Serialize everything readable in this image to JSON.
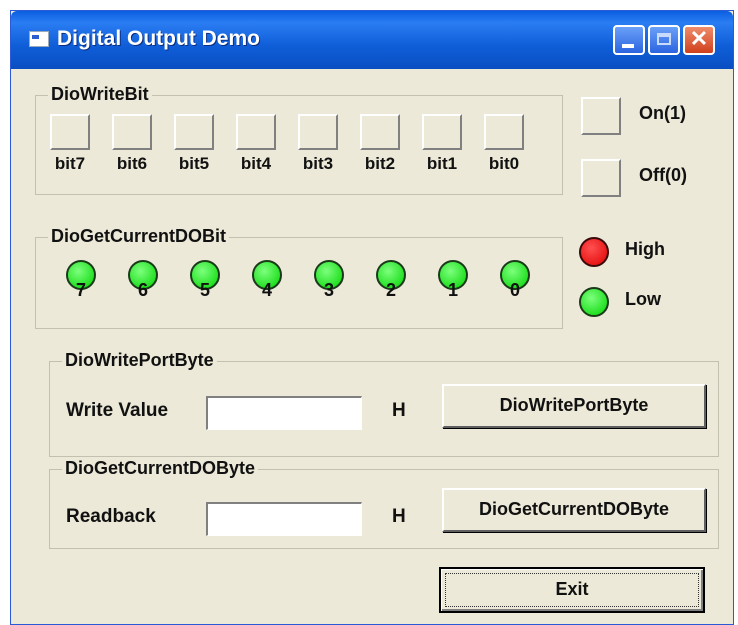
{
  "window": {
    "title": "Digital Output Demo"
  },
  "dio_write_bit": {
    "label": "DioWriteBit",
    "bits": [
      {
        "label": "bit7"
      },
      {
        "label": "bit6"
      },
      {
        "label": "bit5"
      },
      {
        "label": "bit4"
      },
      {
        "label": "bit3"
      },
      {
        "label": "bit2"
      },
      {
        "label": "bit1"
      },
      {
        "label": "bit0"
      }
    ]
  },
  "legend_buttons": {
    "on_label": "On(1)",
    "off_label": "Off(0)"
  },
  "dio_get_current_do_bit": {
    "label": "DioGetCurrentDOBit",
    "leds": [
      {
        "label": "7",
        "state": "low"
      },
      {
        "label": "6",
        "state": "low"
      },
      {
        "label": "5",
        "state": "low"
      },
      {
        "label": "4",
        "state": "low"
      },
      {
        "label": "3",
        "state": "low"
      },
      {
        "label": "2",
        "state": "low"
      },
      {
        "label": "1",
        "state": "low"
      },
      {
        "label": "0",
        "state": "low"
      }
    ]
  },
  "led_legend": {
    "high_label": "High",
    "low_label": "Low",
    "high_color": "#e00000",
    "low_color": "#00d400"
  },
  "dio_write_port_byte": {
    "label": "DioWritePortByte",
    "field_label": "Write Value",
    "value": "",
    "suffix": "H",
    "button_label": "DioWritePortByte"
  },
  "dio_get_current_do_byte": {
    "label": "DioGetCurrentDOByte",
    "field_label": "Readback",
    "value": "",
    "suffix": "H",
    "button_label": "DioGetCurrentDOByte"
  },
  "exit_label": "Exit"
}
